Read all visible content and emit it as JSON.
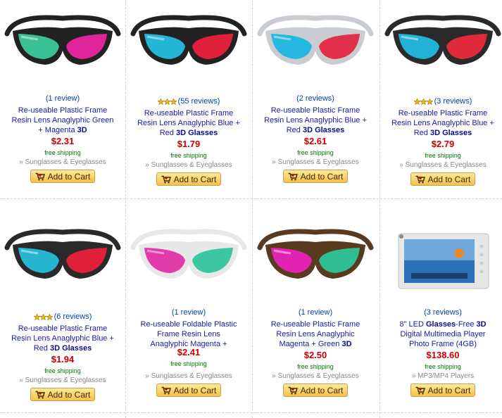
{
  "products": [
    {
      "reviews": "(1 review)",
      "stars": 0,
      "title_parts": [
        {
          "t": "Re-useable Plastic Frame Resin Lens Anaglyphic Green + Magenta "
        },
        {
          "t": "3D",
          "b": true
        }
      ],
      "price": "$2.31",
      "shipping": "free shipping",
      "category": "» Sunglasses & Eyeglasses",
      "cart_label": "Add to Cart",
      "icon": "glasses-icon",
      "colors": {
        "frame": "#222222",
        "left": "#3bbf94",
        "right": "#e0249a"
      }
    },
    {
      "reviews": "(55 reviews)",
      "stars": 3,
      "title_parts": [
        {
          "t": "Re-useable Plastic Frame Resin Lens Anaglyphic Blue + Red "
        },
        {
          "t": "3D Glasses",
          "b": true
        }
      ],
      "price": "$1.79",
      "shipping": "free shipping",
      "category": "» Sunglasses & Eyeglasses",
      "cart_label": "Add to Cart",
      "icon": "glasses-icon",
      "colors": {
        "frame": "#222222",
        "left": "#23b6d6",
        "right": "#e0203a"
      }
    },
    {
      "reviews": "(2 reviews)",
      "stars": 0,
      "title_parts": [
        {
          "t": "Re-useable Plastic Frame Resin Lens Anaglyphic Blue + Red "
        },
        {
          "t": "3D Glasses",
          "b": true
        }
      ],
      "price": "$2.61",
      "shipping": "free shipping",
      "category": "» Sunglasses & Eyeglasses",
      "cart_label": "Add to Cart",
      "icon": "glasses-icon",
      "colors": {
        "frame": "#c9ccd0",
        "left": "#27b8e0",
        "right": "#e2304a"
      }
    },
    {
      "reviews": "(3 reviews)",
      "stars": 3,
      "title_parts": [
        {
          "t": "Re-useable Plastic Frame Resin Lens Anaglyphic Blue + Red "
        },
        {
          "t": "3D Glasses",
          "b": true
        }
      ],
      "price": "$2.79",
      "shipping": "free shipping",
      "category": "» Sunglasses & Eyeglasses",
      "cart_label": "Add to Cart",
      "icon": "glasses-icon",
      "colors": {
        "frame": "#2a2a2a",
        "left": "#22b2d6",
        "right": "#e02a3c"
      }
    },
    {
      "reviews": "(6 reviews)",
      "stars": 3,
      "title_parts": [
        {
          "t": "Re-useable Plastic Frame Resin Lens Anaglyphic Blue + Red "
        },
        {
          "t": "3D Glasses",
          "b": true
        }
      ],
      "price": "$1.94",
      "shipping": "free shipping",
      "category": "» Sunglasses & Eyeglasses",
      "cart_label": "Add to Cart",
      "icon": "glasses-icon",
      "colors": {
        "frame": "#2a2a2a",
        "left": "#26b6d2",
        "right": "#e0203a"
      }
    },
    {
      "reviews": "(1 review)",
      "stars": 0,
      "title_parts": [
        {
          "t": "Re-useable Foldable Plastic Frame Resin Lens Anaglyphic Magenta +"
        }
      ],
      "price": "$2.41",
      "shipping": "free shipping",
      "category": "» Sunglasses & Eyeglasses",
      "cart_label": "Add to Cart",
      "icon": "glasses-icon",
      "colors": {
        "frame": "#e8e8e8",
        "left": "#e23aa8",
        "right": "#3cc7a0"
      }
    },
    {
      "reviews": "(1 review)",
      "stars": 0,
      "title_parts": [
        {
          "t": "Re-useable Plastic Frame Resin Lens Anaglyphic Magenta + Green "
        },
        {
          "t": "3D",
          "b": true
        }
      ],
      "price": "$2.50",
      "shipping": "free shipping",
      "category": "» Sunglasses & Eyeglasses",
      "cart_label": "Add to Cart",
      "icon": "glasses-icon",
      "colors": {
        "frame": "#5a3a1e",
        "left": "#e023b0",
        "right": "#2fbf92"
      }
    },
    {
      "reviews": "(3 reviews)",
      "stars": 0,
      "title_parts": [
        {
          "t": "8\" LED "
        },
        {
          "t": "Glasses",
          "b": true
        },
        {
          "t": "-Free "
        },
        {
          "t": "3D",
          "b": true
        },
        {
          "t": " Digital Multimedia Player Photo Frame (4GB)"
        }
      ],
      "price": "$138.60",
      "shipping": "free shipping",
      "category": "» MP3/MP4 Players",
      "cart_label": "Add to Cart",
      "icon": "photo-frame-icon",
      "colors": {
        "frame": "#e6e6e6",
        "screen": "#2a6fb8",
        "accent": "#e08a30"
      }
    }
  ]
}
